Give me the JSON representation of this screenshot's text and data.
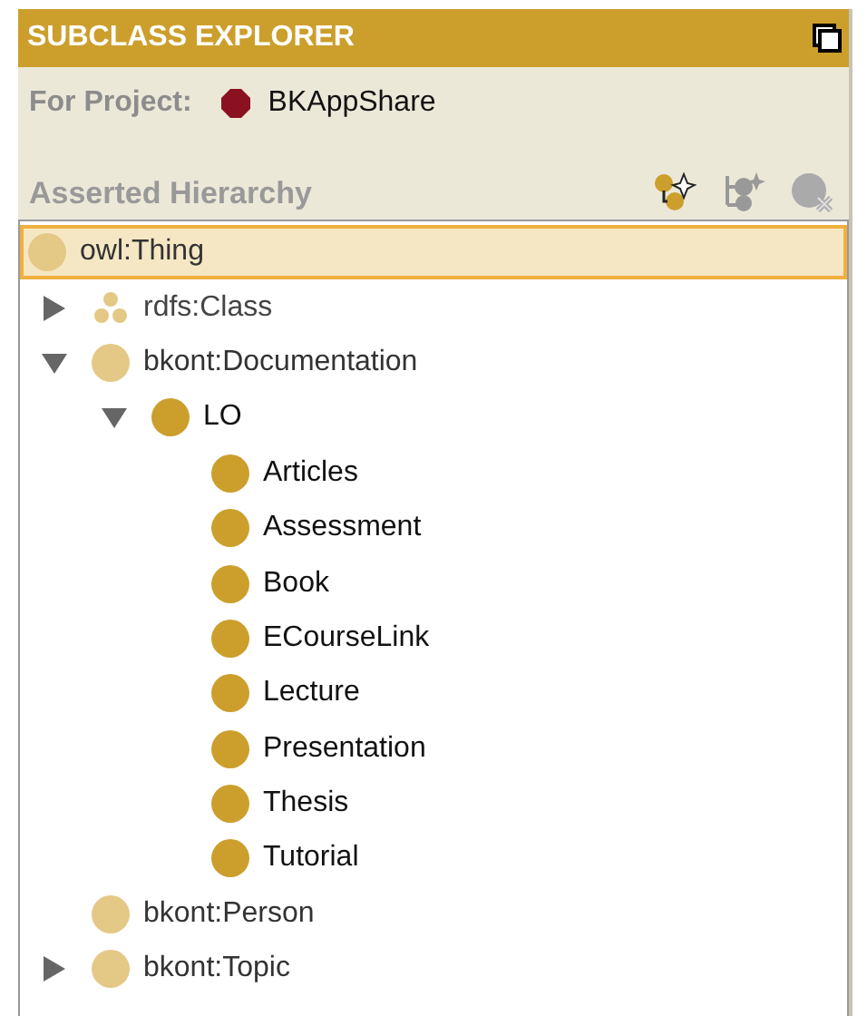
{
  "panel": {
    "title": "SUBCLASS EXPLORER"
  },
  "project": {
    "label": "For Project:",
    "name": "BKAppShare"
  },
  "hierarchy": {
    "title": "Asserted Hierarchy"
  },
  "tree": [
    {
      "label": "owl:Thing",
      "kind": "imported",
      "selected": true,
      "children": [
        {
          "label": "rdfs:Class",
          "kind": "meta",
          "selected": false,
          "expanded": false
        },
        {
          "label": "bkont:Documentation",
          "kind": "imported",
          "selected": false,
          "expanded": true,
          "children": [
            {
              "label": "LO",
              "kind": "local",
              "selected": false,
              "expanded": true,
              "children": [
                {
                  "label": "Articles",
                  "kind": "local",
                  "selected": false
                },
                {
                  "label": "Assessment",
                  "kind": "local",
                  "selected": false
                },
                {
                  "label": "Book",
                  "kind": "local",
                  "selected": false
                },
                {
                  "label": "ECourseLink",
                  "kind": "local",
                  "selected": false
                },
                {
                  "label": "Lecture",
                  "kind": "local",
                  "selected": false
                },
                {
                  "label": "Presentation",
                  "kind": "local",
                  "selected": false
                },
                {
                  "label": "Thesis",
                  "kind": "local",
                  "selected": false
                },
                {
                  "label": "Tutorial",
                  "kind": "local",
                  "selected": false
                }
              ]
            }
          ]
        },
        {
          "label": "bkont:Person",
          "kind": "imported",
          "selected": false
        },
        {
          "label": "bkont:Topic",
          "kind": "imported",
          "selected": false,
          "expanded": false
        }
      ]
    }
  ]
}
